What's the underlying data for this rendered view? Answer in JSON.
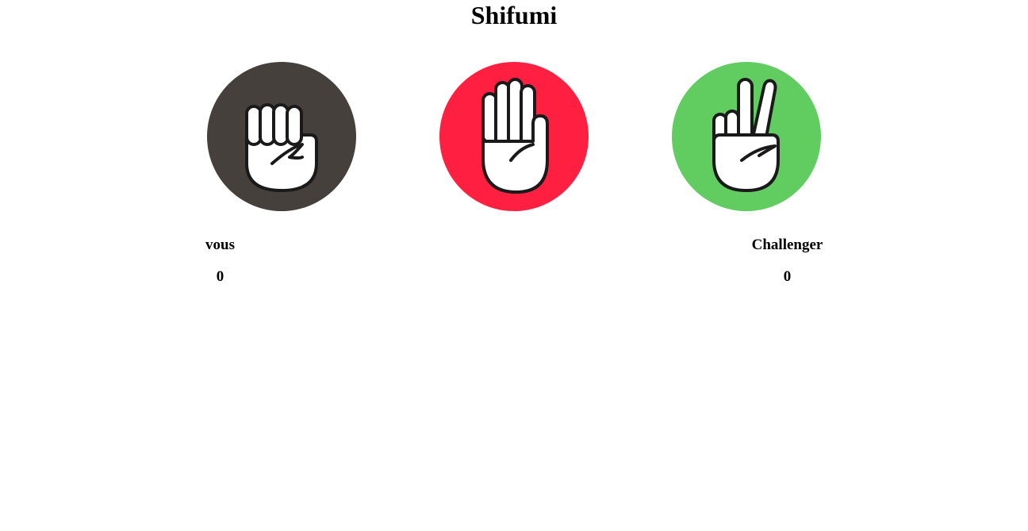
{
  "title": "Shifumi",
  "choices": [
    {
      "name": "rock",
      "icon": "fist-icon",
      "color": "#46403d"
    },
    {
      "name": "paper",
      "icon": "open-hand-icon",
      "color": "#fe1f41"
    },
    {
      "name": "scissors",
      "icon": "victory-hand-icon",
      "color": "#61cd61"
    }
  ],
  "players": {
    "you": {
      "label": "vous",
      "score": "0"
    },
    "challenger": {
      "label": "Challenger",
      "score": "0"
    }
  }
}
